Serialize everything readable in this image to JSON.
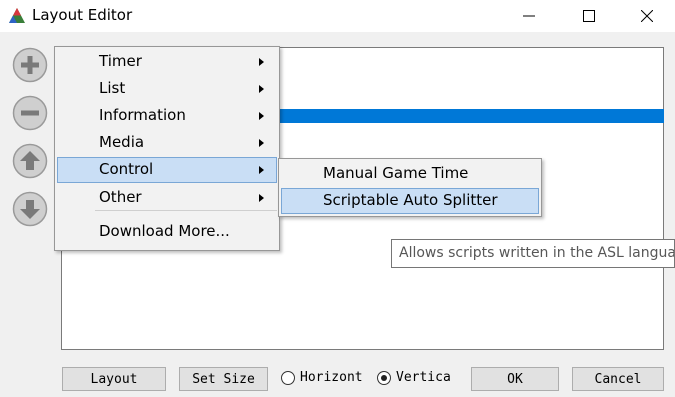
{
  "window": {
    "title": "Layout Editor",
    "icon": "livesplit-triangle-icon",
    "controls": [
      "minimize-icon",
      "maximize-icon",
      "close-icon"
    ]
  },
  "side_buttons": [
    "add-icon",
    "remove-icon",
    "move-up-icon",
    "move-down-icon"
  ],
  "context_menu": {
    "items": [
      {
        "label": "Timer",
        "has_submenu": true
      },
      {
        "label": "List",
        "has_submenu": true
      },
      {
        "label": "Information",
        "has_submenu": true
      },
      {
        "label": "Media",
        "has_submenu": true
      },
      {
        "label": "Control",
        "has_submenu": true,
        "highlighted": true
      },
      {
        "label": "Other",
        "has_submenu": true
      }
    ],
    "footer_item": "Download More..."
  },
  "submenu": {
    "items": [
      {
        "label": "Manual Game Time"
      },
      {
        "label": "Scriptable Auto Splitter",
        "highlighted": true
      }
    ]
  },
  "tooltip": {
    "text": "Allows scripts written in the ASL langua"
  },
  "bottom_bar": {
    "layout_button": "Layout",
    "set_size_button": "Set Size",
    "orientation": [
      {
        "label": "Horizont",
        "selected": false
      },
      {
        "label": "Vertica",
        "selected": true
      }
    ],
    "ok_button": "OK",
    "cancel_button": "Cancel"
  },
  "colors": {
    "selection_blue": "#0078d7",
    "menu_highlight": "#c9def5",
    "window_bg": "#f0f0f0"
  }
}
